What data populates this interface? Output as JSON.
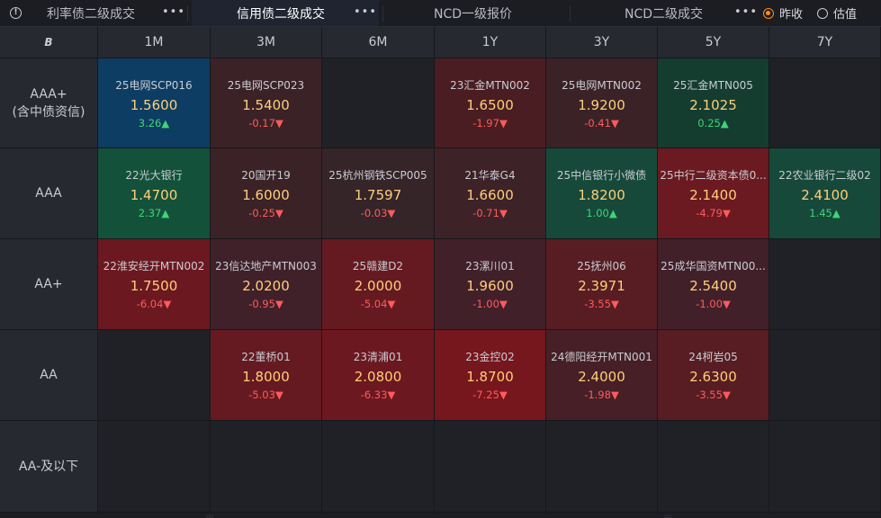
{
  "tabs": [
    {
      "label": "利率债二级成交",
      "active": false
    },
    {
      "label": "信用债二级成交",
      "active": true
    },
    {
      "label": "NCD一级报价",
      "active": false
    },
    {
      "label": "NCD二级成交",
      "active": false
    }
  ],
  "more_glyph": "•••",
  "info_glyph": "!",
  "radio": [
    {
      "label": "昨收",
      "checked": true
    },
    {
      "label": "估值",
      "checked": false
    }
  ],
  "corner_glyph": "B",
  "columns": [
    "1M",
    "3M",
    "6M",
    "1Y",
    "3Y",
    "5Y",
    "7Y"
  ],
  "rows": [
    {
      "label_lines": [
        "AAA+",
        "(含中债资信)"
      ],
      "cells": [
        {
          "name": "25电网SCP016",
          "rate": "1.5600",
          "change": "3.26▲",
          "dir": "up",
          "bg": "#0e3d63"
        },
        {
          "name": "25电网SCP023",
          "rate": "1.5400",
          "change": "-0.17▼",
          "dir": "down",
          "bg": "#3a2226"
        },
        null,
        {
          "name": "23汇金MTN002",
          "rate": "1.6500",
          "change": "-1.97▼",
          "dir": "down",
          "bg": "#4a1d22"
        },
        {
          "name": "25电网MTN002",
          "rate": "1.9200",
          "change": "-0.41▼",
          "dir": "down",
          "bg": "#3a2226"
        },
        {
          "name": "25汇金MTN005",
          "rate": "2.1025",
          "change": "0.25▲",
          "dir": "up",
          "bg": "#143d30"
        },
        null
      ]
    },
    {
      "label_lines": [
        "AAA"
      ],
      "cells": [
        {
          "name": "22光大银行",
          "rate": "1.4700",
          "change": "2.37▲",
          "dir": "up",
          "bg": "#14513a"
        },
        {
          "name": "20国开19",
          "rate": "1.6000",
          "change": "-0.25▼",
          "dir": "down",
          "bg": "#3a2226"
        },
        {
          "name": "25杭州钢铁SCP005",
          "rate": "1.7597",
          "change": "-0.03▼",
          "dir": "down",
          "bg": "#352428"
        },
        {
          "name": "21华泰G4",
          "rate": "1.6600",
          "change": "-0.71▼",
          "dir": "down",
          "bg": "#3d2227"
        },
        {
          "name": "25中信银行小微债",
          "rate": "1.8200",
          "change": "1.00▲",
          "dir": "up",
          "bg": "#17493a"
        },
        {
          "name": "25中行二级资本债0...",
          "rate": "2.1400",
          "change": "-4.79▼",
          "dir": "down",
          "bg": "#6a1a20"
        },
        {
          "name": "22农业银行二级02",
          "rate": "2.4100",
          "change": "1.45▲",
          "dir": "up",
          "bg": "#17493a"
        }
      ]
    },
    {
      "label_lines": [
        "AA+"
      ],
      "cells": [
        {
          "name": "22淮安经开MTN002",
          "rate": "1.7500",
          "change": "-6.04▼",
          "dir": "down",
          "bg": "#6c1820"
        },
        {
          "name": "23信达地产MTN003",
          "rate": "2.0200",
          "change": "-0.95▼",
          "dir": "down",
          "bg": "#40212a"
        },
        {
          "name": "25赣建D2",
          "rate": "2.0000",
          "change": "-5.04▼",
          "dir": "down",
          "bg": "#651a21"
        },
        {
          "name": "23漯川01",
          "rate": "1.9600",
          "change": "-1.00▼",
          "dir": "down",
          "bg": "#42202a"
        },
        {
          "name": "25抚州06",
          "rate": "2.3971",
          "change": "-3.55▼",
          "dir": "down",
          "bg": "#571d23"
        },
        {
          "name": "25成华国资MTN00...",
          "rate": "2.5400",
          "change": "-1.00▼",
          "dir": "down",
          "bg": "#42202a"
        },
        null
      ]
    },
    {
      "label_lines": [
        "AA"
      ],
      "cells": [
        null,
        {
          "name": "22董桥01",
          "rate": "1.8000",
          "change": "-5.03▼",
          "dir": "down",
          "bg": "#651a21"
        },
        {
          "name": "23清浦01",
          "rate": "2.0800",
          "change": "-6.33▼",
          "dir": "down",
          "bg": "#6c1820"
        },
        {
          "name": "23金控02",
          "rate": "1.8700",
          "change": "-7.25▼",
          "dir": "down",
          "bg": "#76161d"
        },
        {
          "name": "24德阳经开MTN001",
          "rate": "2.4000",
          "change": "-1.98▼",
          "dir": "down",
          "bg": "#461f27"
        },
        {
          "name": "24柯岩05",
          "rate": "2.6300",
          "change": "-3.55▼",
          "dir": "down",
          "bg": "#571d23"
        },
        null
      ]
    },
    {
      "label_lines": [
        "AA-及以下"
      ],
      "cells": [
        null,
        null,
        null,
        null,
        null,
        null,
        null
      ]
    }
  ],
  "grip_glyph": "::::"
}
